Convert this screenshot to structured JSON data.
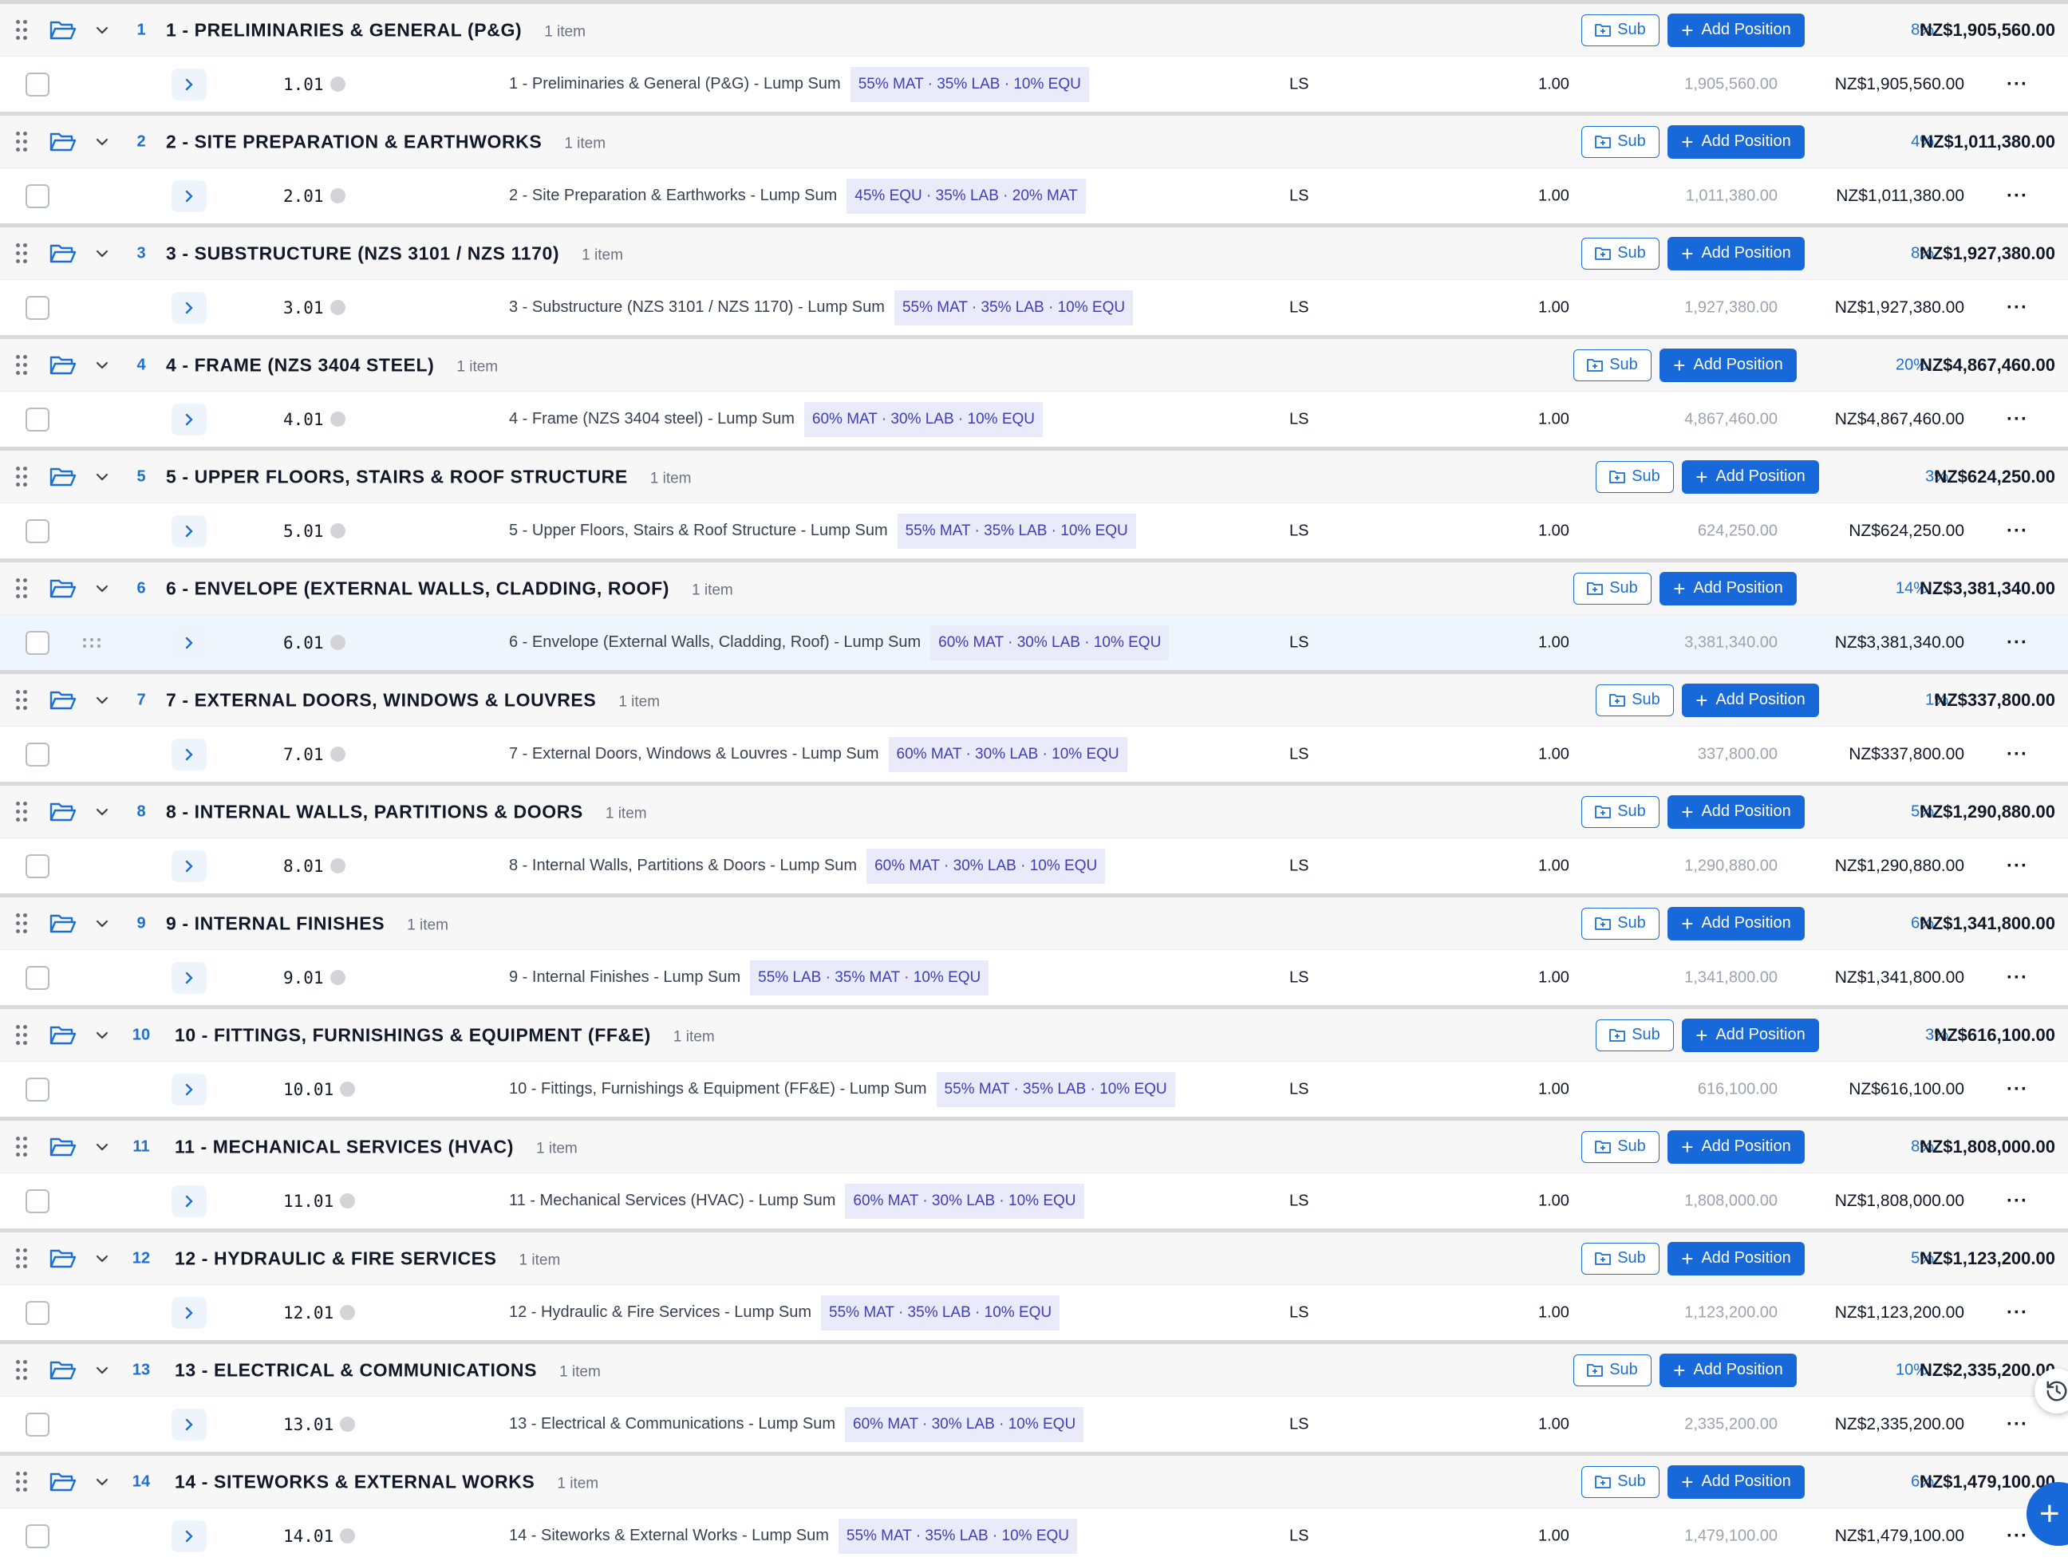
{
  "colors": {
    "accent": "#1768d9",
    "link": "#1d6fd1",
    "tag_bg": "#e9ebfb",
    "tag_text": "#3f3db8",
    "highlight_row": "#eef5fd"
  },
  "icons": {
    "drag": "drag-handle-icon",
    "folder": "folder-open-icon",
    "collapse": "chevron-down-icon",
    "expand": "chevron-right-icon",
    "sub": "folder-plus-icon",
    "more": "more-horizontal-icon"
  },
  "labels": {
    "sub": "Sub",
    "add_position": "Add Position"
  },
  "sections": [
    {
      "num": "1",
      "title": "1 - PRELIMINARIES & GENERAL (P&G)",
      "count": "1 item",
      "pct": "8%",
      "total": "NZ$1,905,560.00",
      "item": {
        "code": "1.01",
        "desc": "1 - Preliminaries & General (P&G) - Lump Sum",
        "tag": "55% MAT · 35% LAB · 10% EQU",
        "unit": "LS",
        "qty": "1.00",
        "rate": "1,905,560.00",
        "total": "NZ$1,905,560.00"
      }
    },
    {
      "num": "2",
      "title": "2 - SITE PREPARATION & EARTHWORKS",
      "count": "1 item",
      "pct": "4%",
      "total": "NZ$1,011,380.00",
      "item": {
        "code": "2.01",
        "desc": "2 - Site Preparation & Earthworks - Lump Sum",
        "tag": "45% EQU · 35% LAB · 20% MAT",
        "unit": "LS",
        "qty": "1.00",
        "rate": "1,011,380.00",
        "total": "NZ$1,011,380.00"
      }
    },
    {
      "num": "3",
      "title": "3 - SUBSTRUCTURE (NZS 3101 / NZS 1170)",
      "count": "1 item",
      "pct": "8%",
      "total": "NZ$1,927,380.00",
      "item": {
        "code": "3.01",
        "desc": "3 - Substructure (NZS 3101 / NZS 1170) - Lump Sum",
        "tag": "55% MAT · 35% LAB · 10% EQU",
        "unit": "LS",
        "qty": "1.00",
        "rate": "1,927,380.00",
        "total": "NZ$1,927,380.00"
      }
    },
    {
      "num": "4",
      "title": "4 - FRAME (NZS 3404 STEEL)",
      "count": "1 item",
      "pct": "20%",
      "total": "NZ$4,867,460.00",
      "item": {
        "code": "4.01",
        "desc": "4 - Frame (NZS 3404 steel) - Lump Sum",
        "tag": "60% MAT · 30% LAB · 10% EQU",
        "unit": "LS",
        "qty": "1.00",
        "rate": "4,867,460.00",
        "total": "NZ$4,867,460.00"
      }
    },
    {
      "num": "5",
      "title": "5 - UPPER FLOORS, STAIRS & ROOF STRUCTURE",
      "count": "1 item",
      "pct": "3%",
      "total": "NZ$624,250.00",
      "item": {
        "code": "5.01",
        "desc": "5 - Upper Floors, Stairs & Roof Structure - Lump Sum",
        "tag": "55% MAT · 35% LAB · 10% EQU",
        "unit": "LS",
        "qty": "1.00",
        "rate": "624,250.00",
        "total": "NZ$624,250.00"
      }
    },
    {
      "num": "6",
      "title": "6 - ENVELOPE (EXTERNAL WALLS, CLADDING, ROOF)",
      "count": "1 item",
      "pct": "14%",
      "total": "NZ$3,381,340.00",
      "item": {
        "code": "6.01",
        "desc": "6 - Envelope (External Walls, Cladding, Roof) - Lump Sum",
        "tag": "60% MAT · 30% LAB · 10% EQU",
        "unit": "LS",
        "qty": "1.00",
        "rate": "3,381,340.00",
        "total": "NZ$3,381,340.00",
        "highlighted": true
      }
    },
    {
      "num": "7",
      "title": "7 - EXTERNAL DOORS, WINDOWS & LOUVRES",
      "count": "1 item",
      "pct": "1%",
      "total": "NZ$337,800.00",
      "item": {
        "code": "7.01",
        "desc": "7 - External Doors, Windows & Louvres - Lump Sum",
        "tag": "60% MAT · 30% LAB · 10% EQU",
        "unit": "LS",
        "qty": "1.00",
        "rate": "337,800.00",
        "total": "NZ$337,800.00"
      }
    },
    {
      "num": "8",
      "title": "8 - INTERNAL WALLS, PARTITIONS & DOORS",
      "count": "1 item",
      "pct": "5%",
      "total": "NZ$1,290,880.00",
      "item": {
        "code": "8.01",
        "desc": "8 - Internal Walls, Partitions & Doors - Lump Sum",
        "tag": "60% MAT · 30% LAB · 10% EQU",
        "unit": "LS",
        "qty": "1.00",
        "rate": "1,290,880.00",
        "total": "NZ$1,290,880.00"
      }
    },
    {
      "num": "9",
      "title": "9 - INTERNAL FINISHES",
      "count": "1 item",
      "pct": "6%",
      "total": "NZ$1,341,800.00",
      "item": {
        "code": "9.01",
        "desc": "9 - Internal Finishes - Lump Sum",
        "tag": "55% LAB · 35% MAT · 10% EQU",
        "unit": "LS",
        "qty": "1.00",
        "rate": "1,341,800.00",
        "total": "NZ$1,341,800.00"
      }
    },
    {
      "num": "10",
      "title": "10 - FITTINGS, FURNISHINGS & EQUIPMENT (FF&E)",
      "count": "1 item",
      "pct": "3%",
      "total": "NZ$616,100.00",
      "item": {
        "code": "10.01",
        "desc": "10 - Fittings, Furnishings & Equipment (FF&E) - Lump Sum",
        "tag": "55% MAT · 35% LAB · 10% EQU",
        "unit": "LS",
        "qty": "1.00",
        "rate": "616,100.00",
        "total": "NZ$616,100.00"
      }
    },
    {
      "num": "11",
      "title": "11 - MECHANICAL SERVICES (HVAC)",
      "count": "1 item",
      "pct": "8%",
      "total": "NZ$1,808,000.00",
      "item": {
        "code": "11.01",
        "desc": "11 - Mechanical Services (HVAC) - Lump Sum",
        "tag": "60% MAT · 30% LAB · 10% EQU",
        "unit": "LS",
        "qty": "1.00",
        "rate": "1,808,000.00",
        "total": "NZ$1,808,000.00"
      }
    },
    {
      "num": "12",
      "title": "12 - HYDRAULIC & FIRE SERVICES",
      "count": "1 item",
      "pct": "5%",
      "total": "NZ$1,123,200.00",
      "item": {
        "code": "12.01",
        "desc": "12 - Hydraulic & Fire Services - Lump Sum",
        "tag": "55% MAT · 35% LAB · 10% EQU",
        "unit": "LS",
        "qty": "1.00",
        "rate": "1,123,200.00",
        "total": "NZ$1,123,200.00"
      }
    },
    {
      "num": "13",
      "title": "13 - ELECTRICAL & COMMUNICATIONS",
      "count": "1 item",
      "pct": "10%",
      "total": "NZ$2,335,200.00",
      "item": {
        "code": "13.01",
        "desc": "13 - Electrical & Communications - Lump Sum",
        "tag": "60% MAT · 30% LAB · 10% EQU",
        "unit": "LS",
        "qty": "1.00",
        "rate": "2,335,200.00",
        "total": "NZ$2,335,200.00"
      }
    },
    {
      "num": "14",
      "title": "14 - SITEWORKS & EXTERNAL WORKS",
      "count": "1 item",
      "pct": "6%",
      "total": "NZ$1,479,100.00",
      "item": {
        "code": "14.01",
        "desc": "14 - Siteworks & External Works - Lump Sum",
        "tag": "55% MAT · 35% LAB · 10% EQU",
        "unit": "LS",
        "qty": "1.00",
        "rate": "1,479,100.00",
        "total": "NZ$1,479,100.00"
      }
    }
  ]
}
